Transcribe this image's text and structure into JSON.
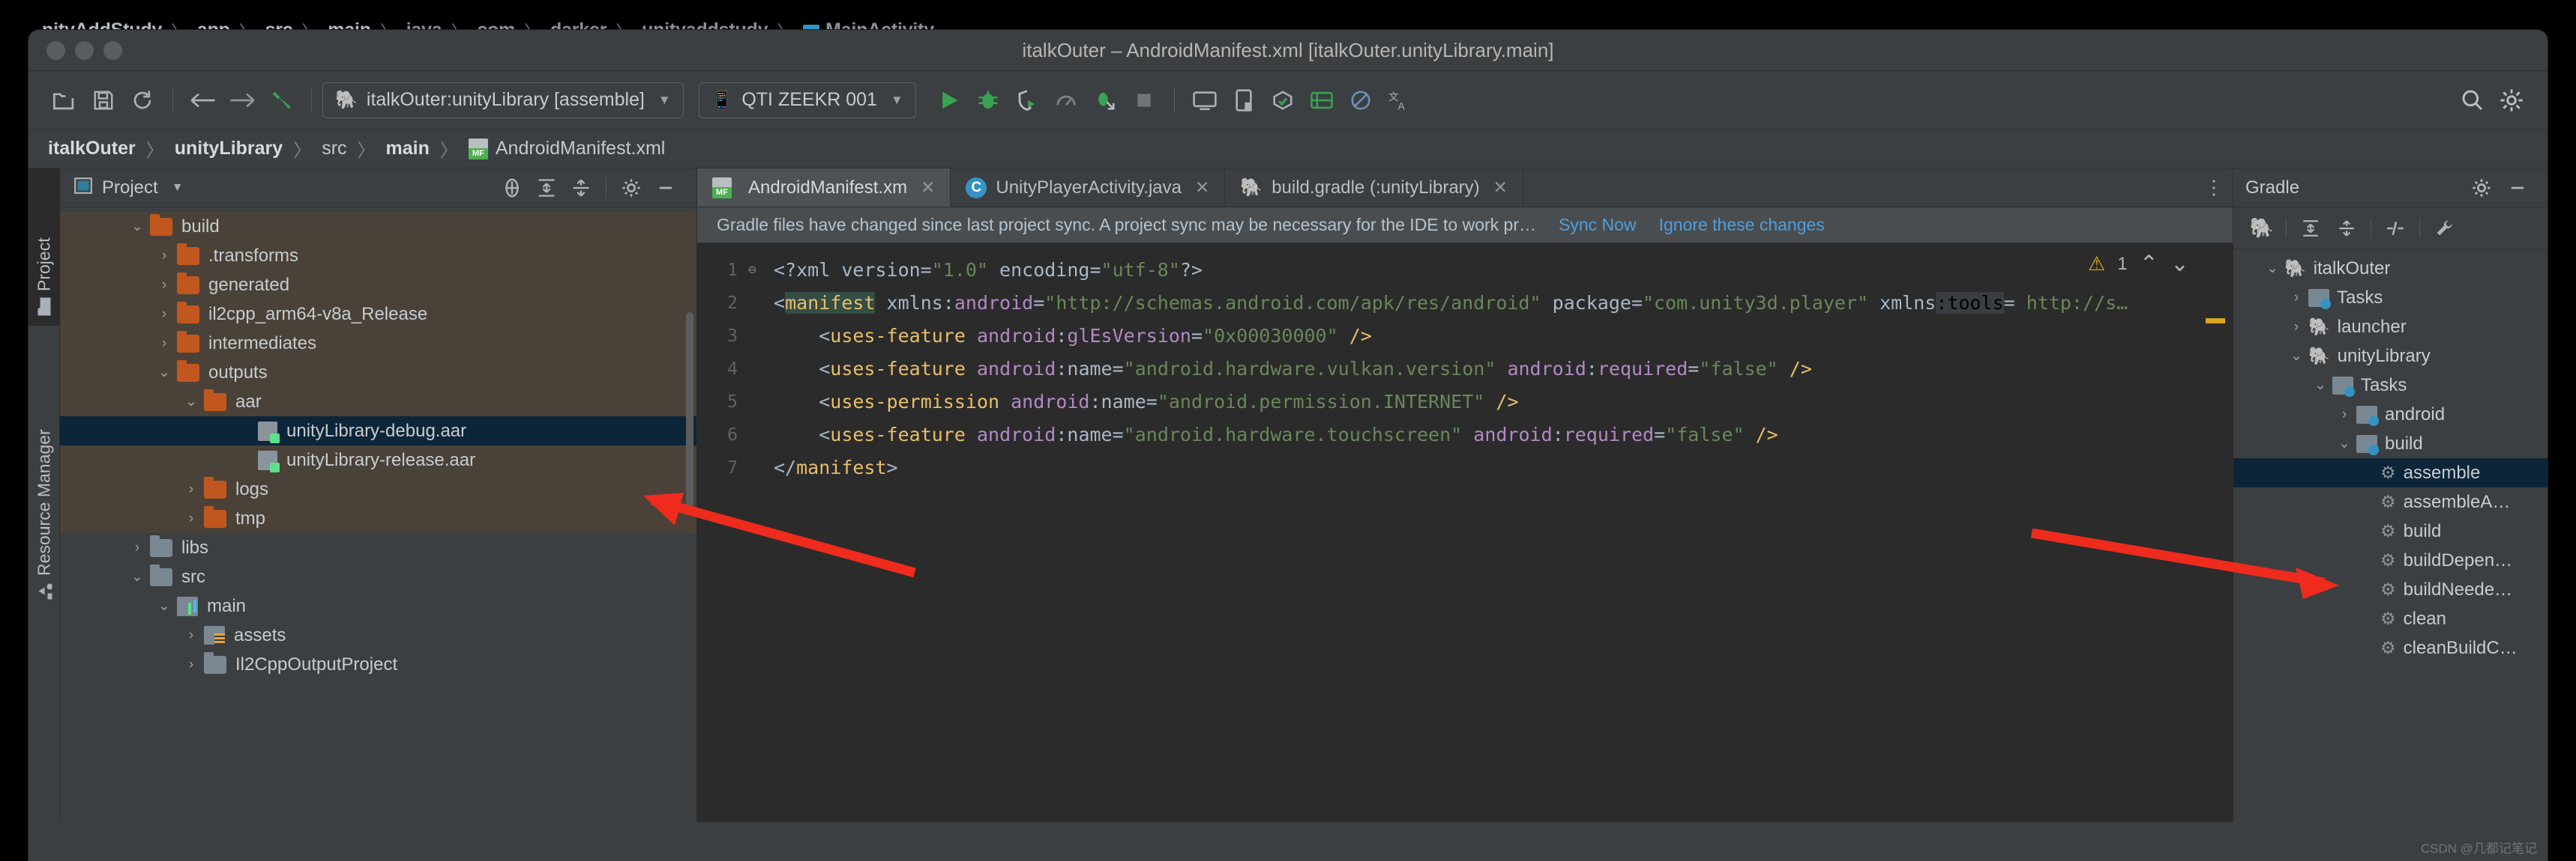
{
  "background_breadcrumb": {
    "items": [
      "nityAddStudy",
      "app",
      "src",
      "main",
      "java",
      "com",
      "darker",
      "unityaddstudy",
      "MainActivity"
    ],
    "separator": "〉"
  },
  "window": {
    "title": "italkOuter – AndroidManifest.xml [italkOuter.unityLibrary.main]"
  },
  "toolbar": {
    "icons": [
      "open-folder-icon",
      "save-icon",
      "sync-icon",
      "back-arrow-icon",
      "forward-arrow-icon",
      "build-hammer-icon"
    ],
    "run_config": "italkOuter:unityLibrary [assemble]",
    "device": "QTI ZEEKR 001",
    "caret": "▼",
    "action_icons": [
      "run-icon",
      "debug-icon",
      "attach-debugger-icon",
      "profiler-icon",
      "run-with-coverage-icon",
      "stop-icon",
      "avd-manager-icon",
      "device-manager-icon",
      "sdk-manager-icon",
      "layout-inspector-icon",
      "no-entry-icon",
      "translate-icon"
    ],
    "search_icon": "search-icon",
    "settings_icon": "gear-icon"
  },
  "pathbar": {
    "crumbs": [
      "italkOuter",
      "unityLibrary",
      "src",
      "main",
      "AndroidManifest.xml"
    ],
    "separator": "〉"
  },
  "left_rail": {
    "items": [
      {
        "label": "Project",
        "icon": "folder-icon",
        "active": true
      },
      {
        "label": "Resource Manager",
        "icon": "resource-icon",
        "active": false
      }
    ]
  },
  "project_panel": {
    "title": "Project",
    "caret": "▼",
    "toolbar_icons": [
      "select-opened-file-icon",
      "expand-all-icon",
      "collapse-all-icon",
      "gear-icon",
      "minimize-icon"
    ],
    "tree": [
      {
        "label": "build",
        "indent": 2,
        "twisty": "⌄",
        "icon": "folder-orange",
        "state": "hl"
      },
      {
        "label": ".transforms",
        "indent": 3,
        "twisty": "›",
        "icon": "folder-orange",
        "state": "hl"
      },
      {
        "label": "generated",
        "indent": 3,
        "twisty": "›",
        "icon": "folder-orange",
        "state": "hl"
      },
      {
        "label": "il2cpp_arm64-v8a_Release",
        "indent": 3,
        "twisty": "›",
        "icon": "folder-orange",
        "state": "hl"
      },
      {
        "label": "intermediates",
        "indent": 3,
        "twisty": "›",
        "icon": "folder-orange",
        "state": "hl"
      },
      {
        "label": "outputs",
        "indent": 3,
        "twisty": "⌄",
        "icon": "folder-orange",
        "state": "hl"
      },
      {
        "label": "aar",
        "indent": 4,
        "twisty": "⌄",
        "icon": "folder-orange",
        "state": "hl"
      },
      {
        "label": "unityLibrary-debug.aar",
        "indent": 6,
        "twisty": "",
        "icon": "aar-file",
        "state": "sel"
      },
      {
        "label": "unityLibrary-release.aar",
        "indent": 6,
        "twisty": "",
        "icon": "aar-file",
        "state": "hl"
      },
      {
        "label": "logs",
        "indent": 4,
        "twisty": "›",
        "icon": "folder-orange",
        "state": "hl"
      },
      {
        "label": "tmp",
        "indent": 4,
        "twisty": "›",
        "icon": "folder-orange",
        "state": "hl"
      },
      {
        "label": "libs",
        "indent": 2,
        "twisty": "›",
        "icon": "folder-grey",
        "state": ""
      },
      {
        "label": "src",
        "indent": 2,
        "twisty": "⌄",
        "icon": "folder-grey",
        "state": ""
      },
      {
        "label": "main",
        "indent": 3,
        "twisty": "⌄",
        "icon": "module-icon",
        "state": ""
      },
      {
        "label": "assets",
        "indent": 4,
        "twisty": "›",
        "icon": "assets-folder",
        "state": ""
      },
      {
        "label": "Il2CppOutputProject",
        "indent": 4,
        "twisty": "›",
        "icon": "folder-grey",
        "state": ""
      }
    ]
  },
  "editor": {
    "tabs": [
      {
        "label": "AndroidManifest.xm",
        "icon": "manifest-icon",
        "active": true,
        "close": "✕"
      },
      {
        "label": "UnityPlayerActivity.java",
        "icon": "class-icon",
        "active": false,
        "close": "✕"
      },
      {
        "label": "build.gradle (:unityLibrary)",
        "icon": "gradle-elephant-icon",
        "active": false,
        "close": "✕"
      }
    ],
    "more_icon": "⋮",
    "notification": {
      "message": "Gradle files have changed since last project sync. A project sync may be necessary for the IDE to work pr…",
      "sync_link": "Sync Now",
      "ignore_link": "Ignore these changes"
    },
    "inspection": {
      "warning_count": "1",
      "warning_icon": "warning-triangle-icon",
      "up_icon": "⌃",
      "down_icon": "⌄"
    },
    "line_numbers": [
      "1",
      "2",
      "3",
      "4",
      "5",
      "6",
      "7"
    ],
    "code_lines": [
      "<?xml version=\"1.0\" encoding=\"utf-8\"?>",
      "<manifest xmlns:android=\"http://schemas.android.com/apk/res/android\" package=\"com.unity3d.player\" xmlns:tools=\"http://s…",
      "    <uses-feature android:glEsVersion=\"0x00030000\" />",
      "    <uses-feature android:name=\"android.hardware.vulkan.version\" android:required=\"false\" />",
      "    <uses-permission android:name=\"android.permission.INTERNET\" />",
      "    <uses-feature android:name=\"android.hardware.touchscreen\" android:required=\"false\" />",
      "</manifest>"
    ]
  },
  "gradle_panel": {
    "title": "Gradle",
    "settings_icon": "gear-icon",
    "minimize_icon": "minimize-icon",
    "toolbar_icons": [
      "gradle-elephant-icon",
      "expand-all-icon",
      "collapse-all-icon",
      "toggle-offline-icon",
      "build-tool-settings-icon"
    ],
    "tree": [
      {
        "label": "italkOuter",
        "indent": 1,
        "twisty": "⌄",
        "icon": "gradle-elephant-icon",
        "state": ""
      },
      {
        "label": "Tasks",
        "indent": 2,
        "twisty": "›",
        "icon": "task-folder-icon",
        "state": ""
      },
      {
        "label": "launcher",
        "indent": 2,
        "twisty": "›",
        "icon": "gradle-elephant-icon",
        "state": ""
      },
      {
        "label": "unityLibrary",
        "indent": 2,
        "twisty": "⌄",
        "icon": "gradle-elephant-icon",
        "state": ""
      },
      {
        "label": "Tasks",
        "indent": 3,
        "twisty": "⌄",
        "icon": "task-folder-icon",
        "state": ""
      },
      {
        "label": "android",
        "indent": 4,
        "twisty": "›",
        "icon": "task-folder-icon",
        "state": ""
      },
      {
        "label": "build",
        "indent": 4,
        "twisty": "⌄",
        "icon": "task-folder-icon",
        "state": ""
      },
      {
        "label": "assemble",
        "indent": 5,
        "twisty": "",
        "icon": "gear-icon",
        "state": "sel"
      },
      {
        "label": "assembleA…",
        "indent": 5,
        "twisty": "",
        "icon": "gear-icon",
        "state": ""
      },
      {
        "label": "build",
        "indent": 5,
        "twisty": "",
        "icon": "gear-icon",
        "state": ""
      },
      {
        "label": "buildDepen…",
        "indent": 5,
        "twisty": "",
        "icon": "gear-icon",
        "state": ""
      },
      {
        "label": "buildNeede…",
        "indent": 5,
        "twisty": "",
        "icon": "gear-icon",
        "state": ""
      },
      {
        "label": "clean",
        "indent": 5,
        "twisty": "",
        "icon": "gear-icon",
        "state": ""
      },
      {
        "label": "cleanBuildC…",
        "indent": 5,
        "twisty": "",
        "icon": "gear-icon",
        "state": ""
      }
    ]
  },
  "annotations": {
    "arrow_color": "#ee2b1c",
    "arrows": [
      "arrow-to-unityLibrary-debug-aar",
      "arrow-to-assemble-task"
    ]
  },
  "watermark": "CSDN @几都记笔记"
}
